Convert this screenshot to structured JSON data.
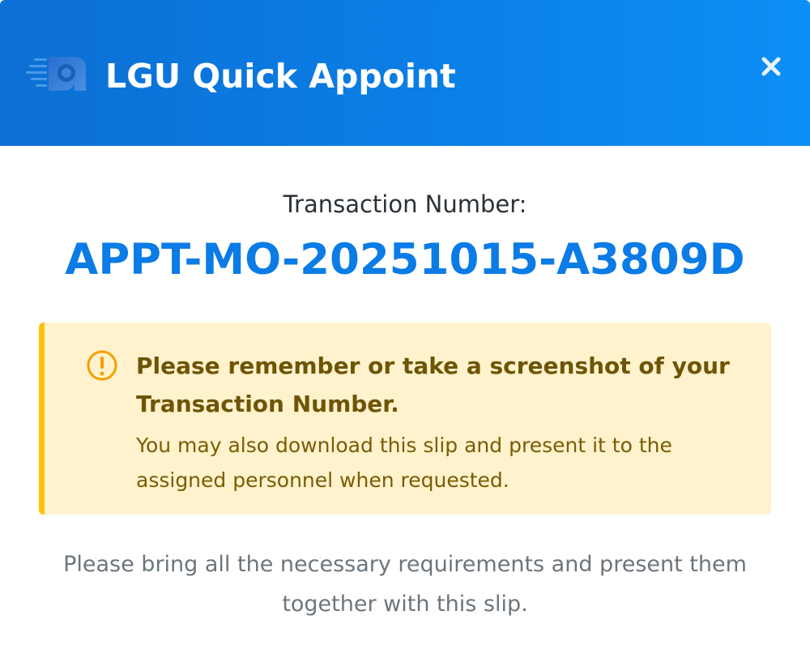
{
  "header": {
    "title": "LGU Quick Appoint",
    "logo_icon": "speed-clock-logo",
    "close_icon": "close-icon",
    "gradient_start": "#0d6fd3",
    "gradient_end": "#0d8ff5"
  },
  "transaction": {
    "label": "Transaction Number:",
    "number": "APPT-MO-20251015-A3809D",
    "number_color": "#0b7be6"
  },
  "notice": {
    "icon": "exclamation-circle-icon",
    "title": "Please remember or take a screenshot of your Transaction Number.",
    "body": "You may also download this slip and present it to the assigned personnel when requested.",
    "background": "#fff2cc",
    "accent": "#ffc107"
  },
  "footer": {
    "note": "Please bring all the necessary requirements and present them together with this slip."
  }
}
